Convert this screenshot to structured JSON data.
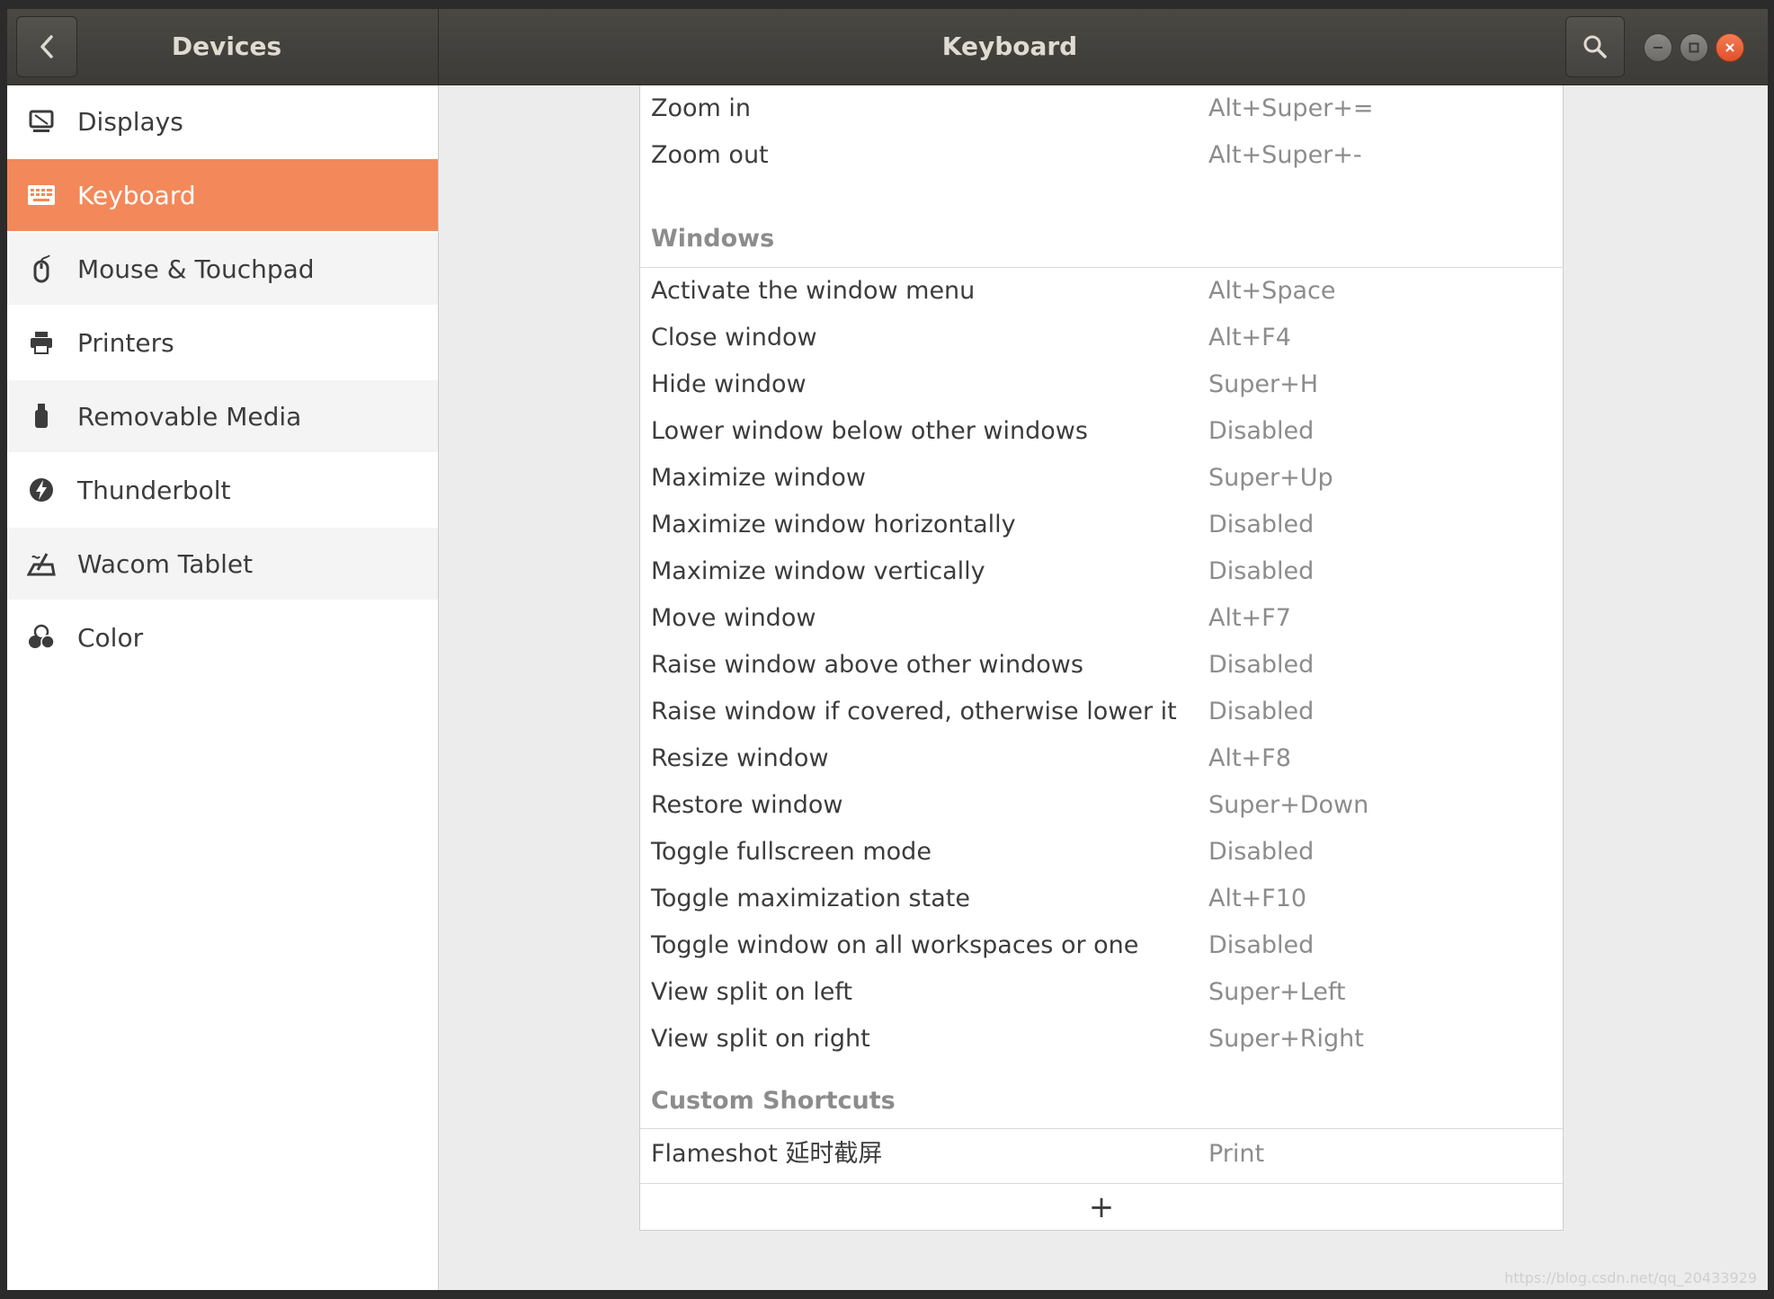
{
  "header": {
    "left_title": "Devices",
    "title": "Keyboard"
  },
  "sidebar": {
    "items": [
      {
        "label": "Displays",
        "icon": "display-icon"
      },
      {
        "label": "Keyboard",
        "icon": "keyboard-icon",
        "active": true
      },
      {
        "label": "Mouse & Touchpad",
        "icon": "mouse-icon"
      },
      {
        "label": "Printers",
        "icon": "printer-icon"
      },
      {
        "label": "Removable Media",
        "icon": "usb-drive-icon"
      },
      {
        "label": "Thunderbolt",
        "icon": "thunderbolt-icon"
      },
      {
        "label": "Wacom Tablet",
        "icon": "tablet-icon"
      },
      {
        "label": "Color",
        "icon": "color-icon"
      }
    ]
  },
  "shortcuts": {
    "top_rows": [
      {
        "action": "Zoom in",
        "accel": "Alt+Super+="
      },
      {
        "action": "Zoom out",
        "accel": "Alt+Super+-"
      }
    ],
    "windows_header": "Windows",
    "windows_rows": [
      {
        "action": "Activate the window menu",
        "accel": "Alt+Space"
      },
      {
        "action": "Close window",
        "accel": "Alt+F4"
      },
      {
        "action": "Hide window",
        "accel": "Super+H"
      },
      {
        "action": "Lower window below other windows",
        "accel": "Disabled"
      },
      {
        "action": "Maximize window",
        "accel": "Super+Up"
      },
      {
        "action": "Maximize window horizontally",
        "accel": "Disabled"
      },
      {
        "action": "Maximize window vertically",
        "accel": "Disabled"
      },
      {
        "action": "Move window",
        "accel": "Alt+F7"
      },
      {
        "action": "Raise window above other windows",
        "accel": "Disabled"
      },
      {
        "action": "Raise window if covered, otherwise lower it",
        "accel": "Disabled"
      },
      {
        "action": "Resize window",
        "accel": "Alt+F8"
      },
      {
        "action": "Restore window",
        "accel": "Super+Down"
      },
      {
        "action": "Toggle fullscreen mode",
        "accel": "Disabled"
      },
      {
        "action": "Toggle maximization state",
        "accel": "Alt+F10"
      },
      {
        "action": "Toggle window on all workspaces or one",
        "accel": "Disabled"
      },
      {
        "action": "View split on left",
        "accel": "Super+Left"
      },
      {
        "action": "View split on right",
        "accel": "Super+Right"
      }
    ],
    "custom_header": "Custom Shortcuts",
    "custom_rows": [
      {
        "action": "Flameshot 延时截屏",
        "accel": "Print"
      }
    ],
    "add_label": "+"
  },
  "watermark": "https://blog.csdn.net/qq_20433929",
  "colors": {
    "accent": "#f3895a",
    "header": "#3c3b37",
    "close": "#e2502a"
  }
}
